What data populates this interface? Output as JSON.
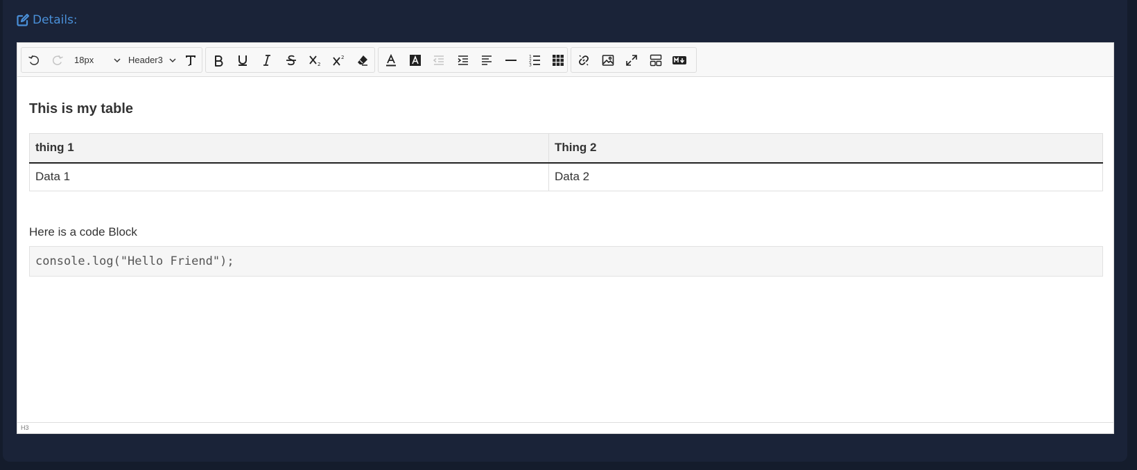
{
  "panel": {
    "title": "Details:",
    "icon": "edit-icon",
    "accent_color": "#4a90d9"
  },
  "toolbar": {
    "font_size": "18px",
    "block_format": "Header3",
    "buttons": [
      "undo",
      "redo",
      "clear-format",
      "bold",
      "underline",
      "italic",
      "strikethrough",
      "subscript",
      "superscript",
      "eraser",
      "font-color",
      "background-color",
      "outdent",
      "indent",
      "align",
      "horizontal-rule",
      "ordered-list",
      "table",
      "link",
      "image",
      "fullscreen",
      "split-view",
      "markdown"
    ]
  },
  "content": {
    "heading": "This is my table",
    "table": {
      "headers": [
        "thing 1",
        "Thing 2"
      ],
      "rows": [
        [
          "Data 1",
          "Data 2"
        ]
      ]
    },
    "paragraph": "Here is a code Block",
    "code": "console.log(\"Hello Friend\");"
  },
  "statusbar": {
    "path": "H3"
  }
}
